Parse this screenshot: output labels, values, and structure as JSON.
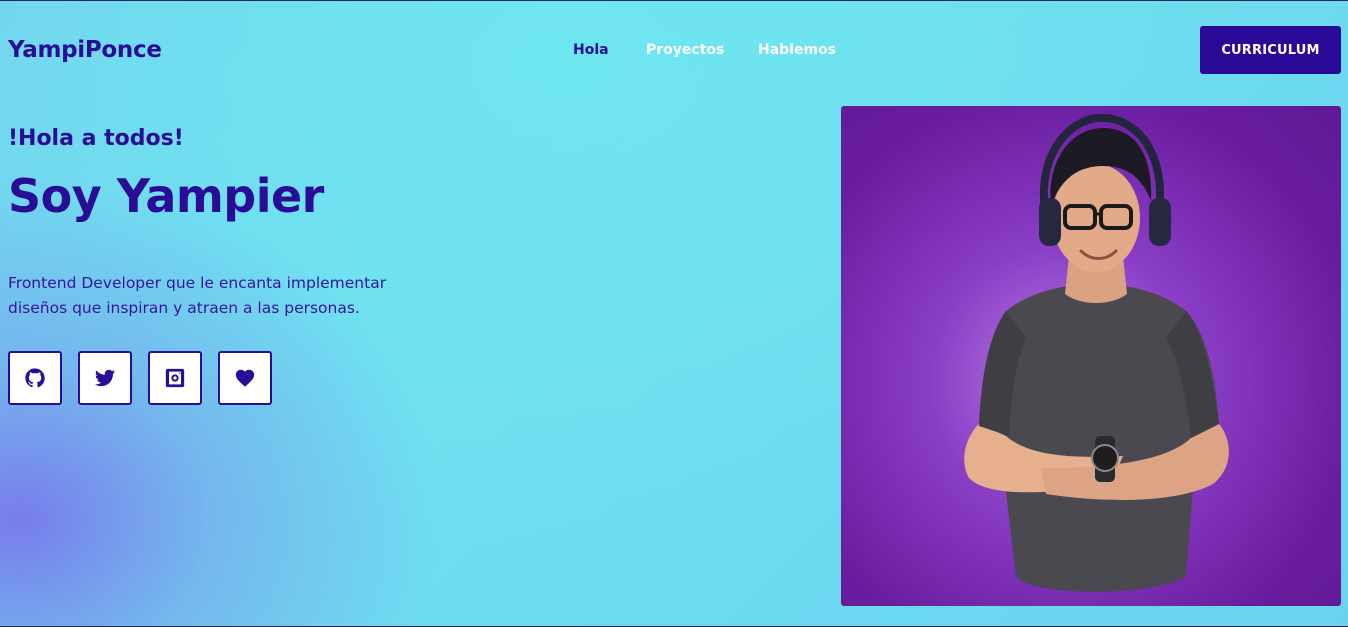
{
  "header": {
    "logo": "YampiPonce",
    "nav": [
      {
        "label": "Hola",
        "active": true
      },
      {
        "label": "Proyectos",
        "active": false
      },
      {
        "label": "Hablemos",
        "active": false
      }
    ],
    "cv_button": "CURRICULUM"
  },
  "hero": {
    "greeting": "!Hola a todos!",
    "name": "Soy Yampier",
    "description_line1": "Frontend Developer que le encanta implementar",
    "description_line2": "diseños que inspiran y atraen a las personas.",
    "socials": [
      {
        "icon": "github-icon"
      },
      {
        "icon": "twitter-icon"
      },
      {
        "icon": "instagram-icon"
      },
      {
        "icon": "heart-icon"
      }
    ],
    "photo": {
      "subject": "portrait"
    }
  },
  "colors": {
    "primary": "#2a0d96",
    "button_bg": "#2a0996",
    "photo_bg": "#6a1c9e"
  }
}
